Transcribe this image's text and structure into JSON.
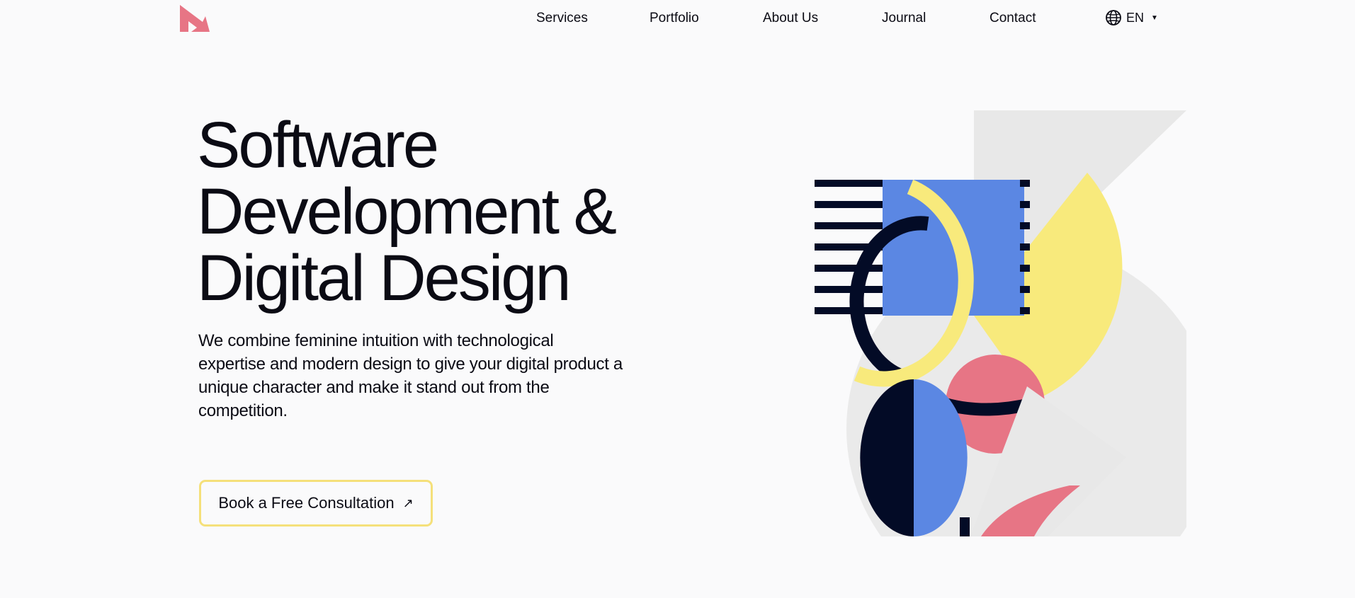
{
  "nav": {
    "items": [
      {
        "label": "Services"
      },
      {
        "label": "Portfolio"
      },
      {
        "label": "About Us"
      },
      {
        "label": "Journal"
      },
      {
        "label": "Contact"
      }
    ],
    "language": "EN"
  },
  "hero": {
    "title_lines": [
      "Software",
      "Development &",
      "Digital Design"
    ],
    "description": "We combine feminine intuition with technological expertise and modern design to give your digital product a unique character and make it stand out from the competition.",
    "cta_label": "Book a Free Consultation"
  },
  "colors": {
    "brand_pink": "#e77585",
    "blue": "#5b87e3",
    "yellow": "#f8ea7c",
    "navy": "#030b26",
    "light_grey": "#e8e8e8",
    "cta_border": "#f5e07a"
  },
  "icons": {
    "logo": "arrow-mark-logo",
    "language": "globe-icon",
    "cta": "arrow-up-right-icon"
  }
}
